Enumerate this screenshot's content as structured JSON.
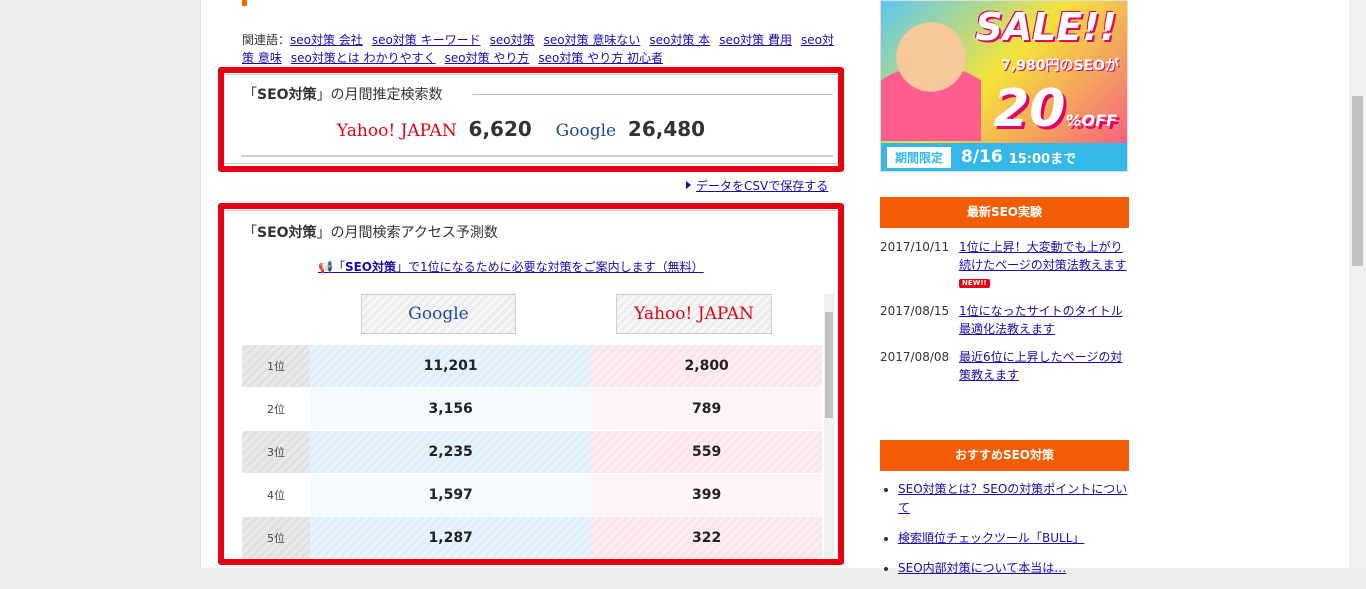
{
  "related": {
    "label": "関連語：",
    "links": [
      "seo対策 会社",
      "seo対策 キーワード",
      "seo対策",
      "seo対策 意味ない",
      "seo対策 本",
      "seo対策 費用",
      "seo対策 意味",
      "seo対策とは わかりやすく",
      "seo対策 やり方",
      "seo対策 やり方 初心者"
    ]
  },
  "volume": {
    "title_pre": "「",
    "title_kw": "SEO対策",
    "title_post": "」の月間推定検索数",
    "yahoo_label": "Yahoo! JAPAN",
    "yahoo_value": "6,620",
    "google_label": "Google",
    "google_value": "26,480"
  },
  "csv_link": "データをCSVで保存する",
  "access": {
    "title_pre": "「",
    "title_kw": "SEO対策",
    "title_post": "」の月間検索アクセス予測数",
    "promo_icon": "megaphone-icon",
    "promo_pre": "「",
    "promo_kw": "SEO対策",
    "promo_post": "」で1位になるために必要な対策をご案内します（無料）",
    "google_tab": "Google",
    "yahoo_tab": "Yahoo! JAPAN",
    "rows": [
      {
        "rank": "1位",
        "google": "11,201",
        "yahoo": "2,800"
      },
      {
        "rank": "2位",
        "google": "3,156",
        "yahoo": "789"
      },
      {
        "rank": "3位",
        "google": "2,235",
        "yahoo": "559"
      },
      {
        "rank": "4位",
        "google": "1,597",
        "yahoo": "399"
      },
      {
        "rank": "5位",
        "google": "1,287",
        "yahoo": "322"
      }
    ]
  },
  "banner": {
    "sale": "SALE!!",
    "sub": "7,980円のSEOが",
    "pct": "20",
    "pct_suffix": "%OFF",
    "tag": "期間限定",
    "date": "8/16",
    "time": "15:00まで"
  },
  "latest": {
    "title": "最新SEO実験",
    "items": [
      {
        "date": "2017/10/11",
        "text": "1位に上昇！大変動でも上がり続けたページの対策法教えます",
        "badge": "NEW!!"
      },
      {
        "date": "2017/08/15",
        "text": "1位になったサイトのタイトル最適化法教えます"
      },
      {
        "date": "2017/08/08",
        "text": "最近6位に上昇したページの対策教えます"
      }
    ]
  },
  "recommend": {
    "title": "おすすめSEO対策",
    "items": [
      "SEO対策とは？SEOの対策ポイントについて",
      "検索順位チェックツール「BULL」",
      "SEO内部対策について本当は…"
    ]
  }
}
